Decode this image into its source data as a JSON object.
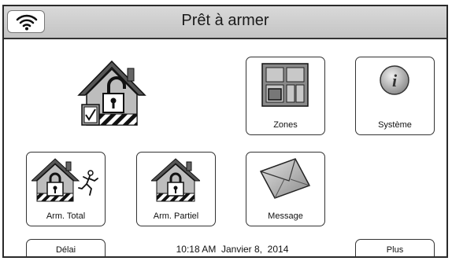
{
  "header": {
    "title": "Prêt à armer",
    "wifi_icon": "wifi-icon"
  },
  "status": {
    "icon": "house-unlocked-ready-icon"
  },
  "tiles": {
    "zones": {
      "label": "Zones",
      "icon": "zones-grid-icon"
    },
    "systeme": {
      "label": "Système",
      "icon": "info-icon"
    },
    "arm_total": {
      "label": "Arm. Total",
      "icon": "house-lock-away-icon"
    },
    "arm_partiel": {
      "label": "Arm. Partiel",
      "icon": "house-lock-stay-icon"
    },
    "message": {
      "label": "Message",
      "icon": "envelope-icon"
    }
  },
  "footer": {
    "delai_label": "Délai",
    "datetime": "10:18 AM  Janvier 8,  2014",
    "plus_label": "Plus"
  }
}
